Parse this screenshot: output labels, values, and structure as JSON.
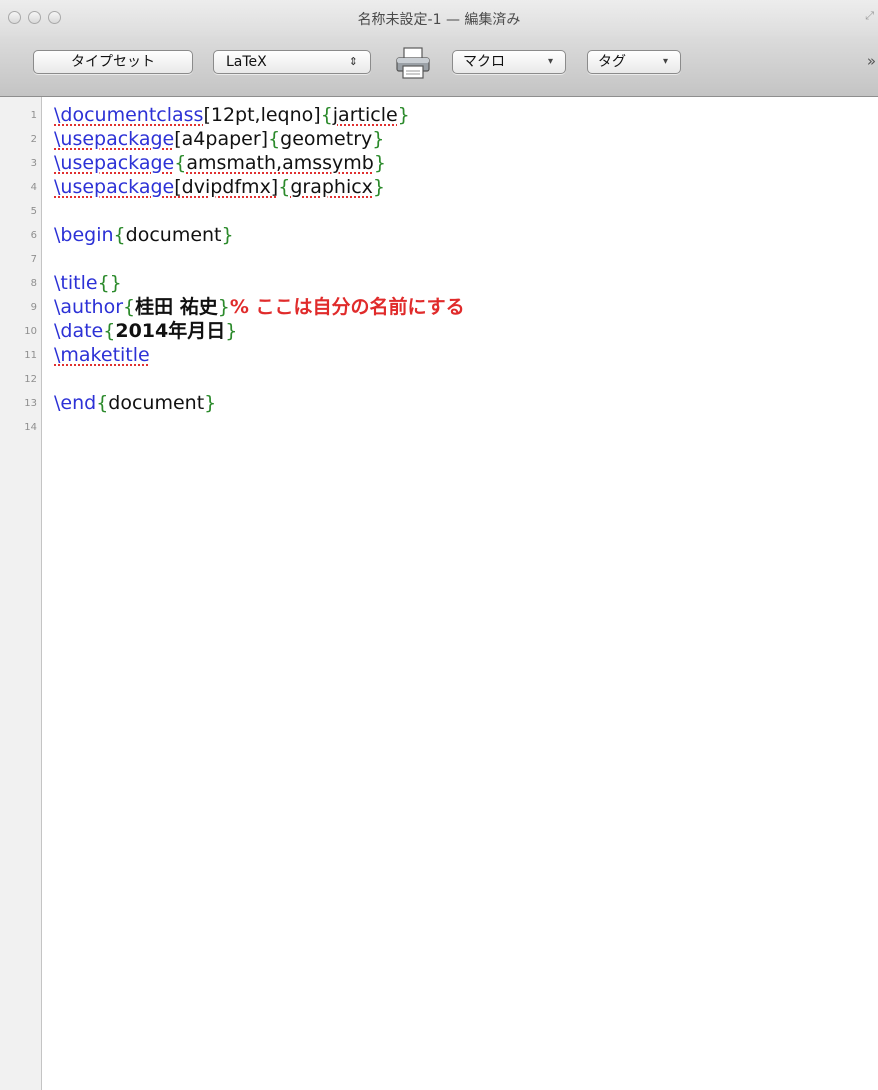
{
  "window": {
    "title": "名称未設定-1 — 編集済み"
  },
  "toolbar": {
    "typeset_label": "タイプセット",
    "format_value": "LaTeX",
    "format_arrows": "⇕",
    "macro_label": "マクロ",
    "tags_label": "タグ",
    "caret": "▾",
    "overflow": "»",
    "print_icon": "printer-icon"
  },
  "editor": {
    "line_numbers": [
      "1",
      "2",
      "3",
      "4",
      "5",
      "6",
      "7",
      "8",
      "9",
      "10",
      "11",
      "12",
      "13",
      "14"
    ],
    "lines": {
      "l1": {
        "cmd": "\\documentclass",
        "opt": "[12pt,leqno]",
        "ob": "{",
        "arg": "jarticle",
        "cb": "}"
      },
      "l2": {
        "cmd": "\\usepackage",
        "opt": "[a4paper]",
        "ob": "{",
        "arg": "geometry",
        "cb": "}"
      },
      "l3": {
        "cmd": "\\usepackage",
        "ob": "{",
        "arg": "amsmath,amssymb",
        "cb": "}"
      },
      "l4": {
        "cmd": "\\usepackage",
        "opt": "[dvipdfmx]",
        "ob": "{",
        "arg": "graphicx",
        "cb": "}"
      },
      "l6": {
        "cmd": "\\begin",
        "ob": "{",
        "arg": "document",
        "cb": "}"
      },
      "l8": {
        "cmd": "\\title",
        "ob": "{",
        "cb": "}"
      },
      "l9": {
        "cmd": "\\author",
        "ob": "{",
        "arg": "桂田 祐史",
        "cb": "}",
        "comment": "% ここは自分の名前にする"
      },
      "l10": {
        "cmd": "\\date",
        "ob": "{",
        "arg": "2014年月日",
        "cb": "}"
      },
      "l11": {
        "cmd": "\\maketitle"
      },
      "l13": {
        "cmd": "\\end",
        "ob": "{",
        "arg": "document",
        "cb": "}"
      }
    }
  },
  "colors": {
    "command": "#2c31d6",
    "brace": "#2b8a2b",
    "comment": "#e02b2b"
  }
}
